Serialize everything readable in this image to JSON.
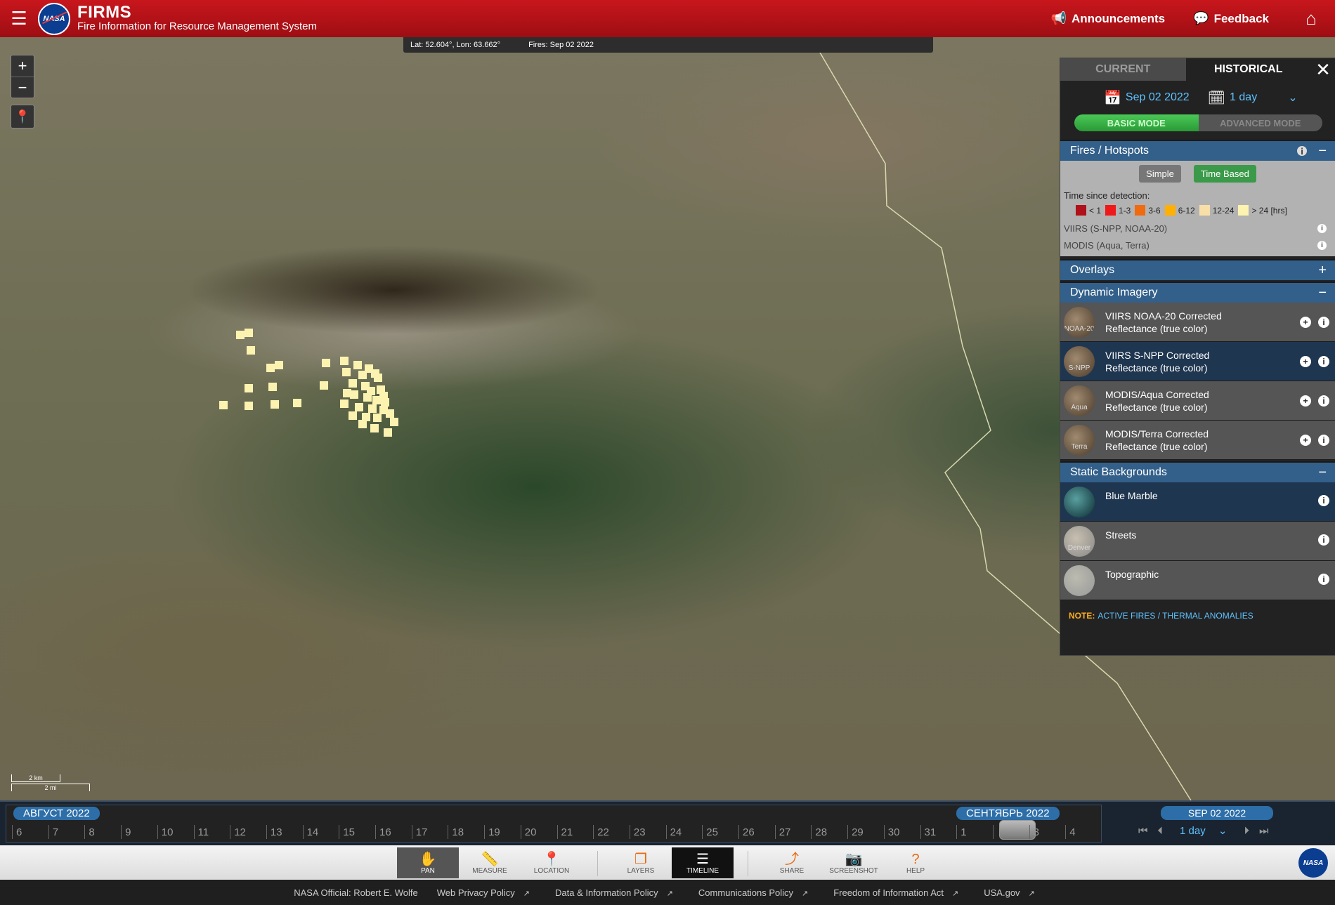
{
  "header": {
    "logo_text": "NASA",
    "title": "FIRMS",
    "subtitle": "Fire Information for Resource Management System",
    "announcements": "Announcements",
    "feedback": "Feedback"
  },
  "map": {
    "coords": "Lat: 52.604°, Lon: 63.662°",
    "fires_date": "Fires: Sep 02 2022",
    "scale_km": "2 km",
    "scale_mi": "2 mi"
  },
  "panel": {
    "tab_current": "CURRENT",
    "tab_historical": "HISTORICAL",
    "date": "Sep 02 2022",
    "interval": "1 day",
    "basic_mode": "BASIC MODE",
    "advanced_mode": "ADVANCED MODE",
    "fires_header": "Fires / Hotspots",
    "btn_simple": "Simple",
    "btn_time_based": "Time Based",
    "time_since": "Time since detection:",
    "legend": [
      {
        "label": "< 1",
        "color": "#b0101a"
      },
      {
        "label": "1-3",
        "color": "#f01818"
      },
      {
        "label": "3-6",
        "color": "#f06a10"
      },
      {
        "label": "6-12",
        "color": "#ffb000"
      },
      {
        "label": "12-24",
        "color": "#f8dfa8"
      },
      {
        "label": "> 24 [hrs]",
        "color": "#fdf3b0"
      }
    ],
    "viirs": "VIIRS (S-NPP, NOAA-20)",
    "modis": "MODIS (Aqua, Terra)",
    "overlays_header": "Overlays",
    "dynamic_header": "Dynamic Imagery",
    "dynamic_layers": [
      {
        "label": "VIIRS NOAA-20 Corrected Reflectance (true color)",
        "thumb": "NOAA-20"
      },
      {
        "label": "VIIRS S-NPP Corrected Reflectance (true color)",
        "thumb": "S-NPP"
      },
      {
        "label": "MODIS/Aqua Corrected Reflectance (true color)",
        "thumb": "Aqua"
      },
      {
        "label": "MODIS/Terra Corrected Reflectance (true color)",
        "thumb": "Terra"
      }
    ],
    "static_header": "Static Backgrounds",
    "static_layers": [
      {
        "label": "Blue Marble",
        "thumb": ""
      },
      {
        "label": "Streets",
        "thumb": "Denver"
      },
      {
        "label": "Topographic",
        "thumb": ""
      }
    ],
    "note_label": "NOTE:",
    "note_link": "ACTIVE FIRES / THERMAL ANOMALIES"
  },
  "timeline": {
    "month1": "АВГУСТ 2022",
    "month2": "СЕНТЯБРЬ 2022",
    "days_aug": [
      "6",
      "7",
      "8",
      "9",
      "10",
      "11",
      "12",
      "13",
      "14",
      "15",
      "16",
      "17",
      "18",
      "19",
      "20",
      "21",
      "22",
      "23",
      "24",
      "25",
      "26",
      "27",
      "28",
      "29",
      "30",
      "31"
    ],
    "days_sep": [
      "1",
      "",
      "3",
      "4"
    ],
    "current_date": "SEP 02 2022",
    "interval": "1 day"
  },
  "toolbar": {
    "pan": "PAN",
    "measure": "MEASURE",
    "location": "LOCATION",
    "layers": "LAYERS",
    "timeline": "TIMELINE",
    "share": "SHARE",
    "screenshot": "SCREENSHOT",
    "help": "HELP"
  },
  "footer": {
    "official": "NASA Official: Robert E. Wolfe",
    "privacy": "Web Privacy Policy",
    "data_policy": "Data & Information Policy",
    "comm_policy": "Communications Policy",
    "foia": "Freedom of Information Act",
    "usa": "USA.gov"
  },
  "hotspots": {
    "color": "#fdf3b0"
  }
}
